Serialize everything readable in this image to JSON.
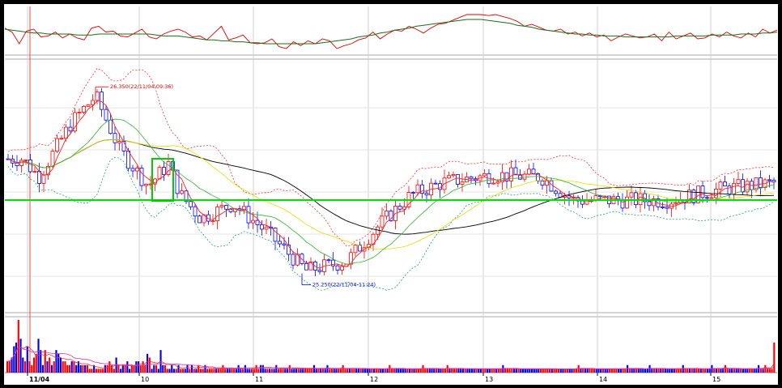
{
  "chart_data": [
    {
      "type": "line",
      "panel": "oscillator",
      "series": [
        {
          "color": "#e00000",
          "values": [
            56,
            52,
            40,
            53,
            55,
            47,
            48,
            52,
            46,
            50,
            46,
            44,
            56,
            58,
            52,
            53,
            48,
            47,
            51,
            55,
            47,
            45,
            50,
            53,
            55,
            52,
            47,
            48,
            44,
            51,
            58,
            44,
            46,
            49,
            41,
            40,
            41,
            45,
            37,
            35,
            42,
            38,
            43,
            40,
            45,
            43,
            35,
            38,
            40,
            44,
            46,
            52,
            45,
            50,
            54,
            53,
            58,
            55,
            51,
            56,
            60,
            61,
            64,
            67,
            70,
            70,
            70,
            69,
            70,
            68,
            66,
            63,
            58,
            60,
            57,
            54,
            53,
            55,
            50,
            52,
            48,
            51,
            47,
            49,
            43,
            47,
            50,
            48,
            46,
            47,
            50,
            43,
            52,
            45,
            48,
            51,
            45,
            46,
            50,
            47,
            52,
            48,
            46,
            51,
            47,
            55,
            51,
            54
          ]
        },
        {
          "color": "#1c6b1c",
          "values": [
            55,
            54,
            53,
            52,
            51,
            51,
            50,
            50,
            50,
            50,
            49,
            49,
            49,
            50,
            50,
            50,
            50,
            50,
            50,
            50,
            50,
            49,
            48,
            48,
            48,
            47,
            46,
            45,
            44,
            44,
            43,
            43,
            42,
            42,
            41,
            41,
            40,
            40,
            40,
            40,
            40,
            40,
            40,
            40,
            41,
            42,
            43,
            44,
            45,
            47,
            48,
            49,
            51,
            52,
            54,
            55,
            56,
            58,
            59,
            60,
            61,
            62,
            63,
            64,
            65,
            65,
            65,
            64,
            63,
            62,
            61,
            59,
            58,
            57,
            55,
            54,
            53,
            52,
            51,
            50,
            50,
            49,
            49,
            48,
            48,
            48,
            47,
            47,
            47,
            47,
            47,
            47,
            47,
            48,
            48,
            48,
            48,
            48,
            49,
            49,
            49,
            49,
            50,
            50,
            50,
            51,
            51,
            52
          ]
        }
      ]
    },
    {
      "type": "candlestick",
      "panel": "price",
      "x_ticks": [
        "11/04",
        "10",
        "11",
        "12",
        "13",
        "14",
        "15"
      ],
      "horizontal_line_color": "#00e000",
      "up_color": "#ff0000",
      "down_color": "#0000ff",
      "annotations": [
        {
          "text": "26.350(22/11/04-09:36)",
          "value": 26.35
        },
        {
          "text": "25.250(22/11/04-11:24)",
          "value": 25.25
        }
      ]
    },
    {
      "type": "bar",
      "panel": "volume",
      "values": [
        3,
        3,
        4,
        7,
        8,
        14,
        9,
        4,
        3,
        7,
        3,
        2,
        4,
        5,
        9,
        6,
        2,
        6,
        3,
        4,
        2,
        3,
        6,
        5,
        4,
        3,
        3,
        2,
        2,
        3,
        3,
        2,
        3,
        2,
        2,
        2,
        2,
        1,
        1,
        2,
        1,
        1,
        1,
        1,
        2,
        2,
        3,
        2,
        1,
        4,
        2,
        1,
        2,
        2,
        3,
        1,
        2,
        2,
        3,
        3,
        2,
        3,
        2,
        5,
        4,
        1,
        2,
        2,
        1,
        6,
        2,
        2,
        1,
        1,
        2,
        1,
        1,
        2,
        1,
        1,
        1,
        2,
        1,
        2,
        1,
        1,
        2,
        1,
        1,
        2,
        1,
        1,
        1,
        1,
        1,
        1,
        1,
        2,
        1,
        1,
        1,
        1,
        1,
        1,
        2,
        1,
        1,
        2,
        1,
        1,
        1,
        1,
        2,
        1,
        2,
        2,
        1,
        1,
        1,
        1,
        1,
        2,
        1,
        1,
        1,
        1,
        1,
        2,
        1,
        1,
        1,
        1,
        1,
        1,
        1,
        1,
        1,
        1,
        2,
        1,
        1,
        1,
        1,
        1,
        2,
        1,
        1,
        1,
        1,
        1,
        1,
        2,
        1,
        1,
        1,
        1,
        1,
        1,
        1,
        1,
        1,
        1,
        1,
        1,
        1,
        1,
        1,
        1,
        1,
        1,
        1,
        1,
        2,
        1,
        1,
        1,
        1,
        1,
        1,
        1,
        1,
        1,
        1,
        1,
        1,
        1,
        1,
        2,
        1,
        1,
        1,
        1,
        1,
        1,
        1,
        1,
        1,
        1,
        2,
        1,
        1,
        1,
        1,
        1,
        1,
        1,
        1,
        1,
        1,
        1,
        1,
        1,
        1,
        1,
        1,
        1,
        1,
        1,
        1,
        1,
        1,
        1,
        1,
        2,
        1,
        1,
        1,
        1,
        1,
        1,
        1,
        1,
        1,
        1,
        1,
        1,
        1,
        1,
        1,
        1,
        1,
        1,
        1,
        1,
        1,
        1,
        1,
        1,
        1,
        1,
        1,
        1,
        1,
        1,
        1,
        1,
        1,
        2,
        1,
        1,
        1,
        1,
        1,
        1,
        1,
        1,
        1,
        1,
        1,
        1,
        1,
        1,
        1,
        1,
        1,
        1,
        1,
        1,
        1,
        2,
        1,
        1,
        1,
        1,
        1,
        1,
        1,
        1,
        1,
        2,
        1,
        1,
        1,
        1,
        1,
        1,
        1,
        1,
        1,
        1,
        1,
        1,
        1,
        1,
        2,
        1,
        1,
        1,
        1,
        1,
        1,
        1,
        1,
        1,
        1,
        1,
        1,
        2,
        1,
        1,
        1,
        1,
        1,
        2,
        1,
        1,
        1,
        1,
        1,
        1,
        1,
        1,
        1,
        1,
        1,
        1,
        1,
        1,
        2,
        1,
        1,
        2,
        1,
        1,
        1,
        8
      ],
      "colors_rule": "red if up bar, blue if down bar"
    }
  ]
}
